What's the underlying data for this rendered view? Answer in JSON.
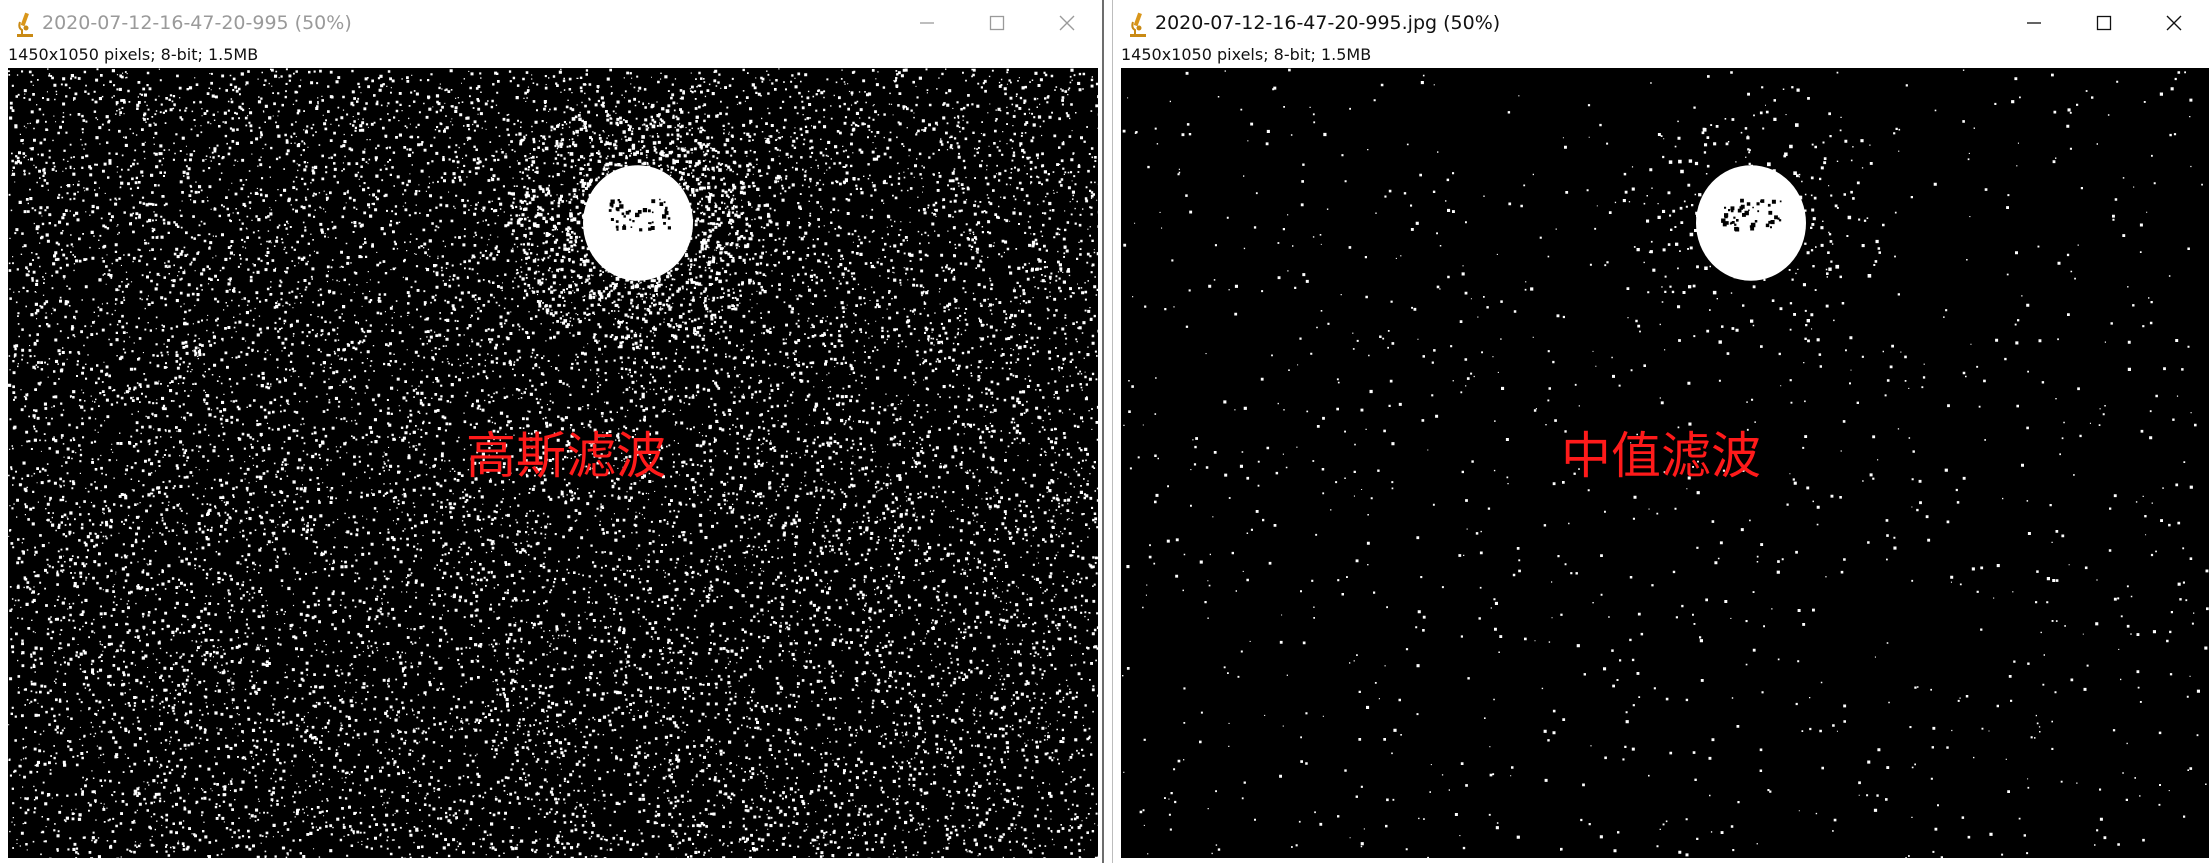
{
  "windows": [
    {
      "id": "left",
      "title": "2020-07-12-16-47-20-995 (50%)",
      "info": "1450x1050 pixels; 8-bit; 1.5MB",
      "active": false,
      "overlay_label": "高斯滤波",
      "noise_density": "high",
      "controls": [
        "minimize-icon",
        "maximize-icon",
        "close-icon"
      ]
    },
    {
      "id": "right",
      "title": "2020-07-12-16-47-20-995.jpg (50%)",
      "info": "1450x1050 pixels; 8-bit; 1.5MB",
      "active": true,
      "overlay_label": "中值滤波",
      "noise_density": "low",
      "controls": [
        "minimize-icon",
        "maximize-icon",
        "close-icon"
      ]
    }
  ],
  "colors": {
    "image_background": "#000000",
    "speckle": "#ffffff",
    "overlay_label": "#ff1a1a",
    "inactive_title": "#9a9a9a",
    "active_title": "#111111"
  },
  "icons": {
    "app": "microscope-icon",
    "minimize": "minimize-icon",
    "maximize": "maximize-icon",
    "close": "close-icon"
  }
}
